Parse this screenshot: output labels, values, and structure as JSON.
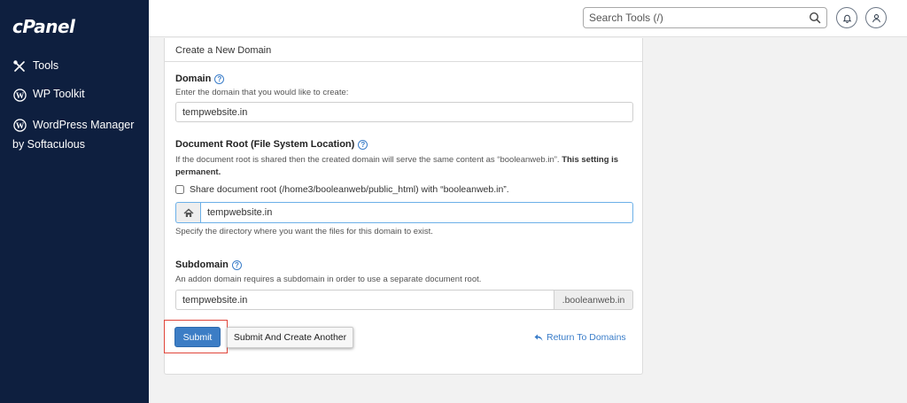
{
  "sidebar": {
    "logo": "cPanel",
    "items": [
      {
        "label": "Tools",
        "icon": "tools-icon"
      },
      {
        "label": "WP Toolkit",
        "icon": "wordpress-icon"
      },
      {
        "label_line1": "WordPress Manager",
        "label_line2": "by Softaculous",
        "icon": "wordpress-icon"
      }
    ]
  },
  "header": {
    "search_placeholder": "Search Tools (/)",
    "icons": [
      "search-icon",
      "bell-icon",
      "user-icon"
    ]
  },
  "form": {
    "title": "Create a New Domain",
    "domain": {
      "label": "Domain",
      "hint": "Enter the domain that you would like to create:",
      "value": "tempwebsite.in"
    },
    "document_root": {
      "label": "Document Root (File System Location)",
      "hint_text": "If the document root is shared then the created domain will serve the same content as “booleanweb.in”.",
      "hint_bold": "This setting is permanent.",
      "checkbox_label": "Share document root (/home3/booleanweb/public_html) with “booleanweb.in”.",
      "checkbox_checked": false,
      "value": "tempwebsite.in",
      "after_hint": "Specify the directory where you want the files for this domain to exist."
    },
    "subdomain": {
      "label": "Subdomain",
      "hint": "An addon domain requires a subdomain in order to use a separate document root.",
      "value": "tempwebsite.in",
      "suffix": ".booleanweb.in"
    },
    "buttons": {
      "submit": "Submit",
      "submit_another": "Submit And Create Another",
      "return": "Return To Domains"
    }
  },
  "colors": {
    "sidebar_bg": "#0e1f3f",
    "primary": "#3c7dc5",
    "link": "#3a7dc9",
    "highlight": "#e0453a"
  }
}
